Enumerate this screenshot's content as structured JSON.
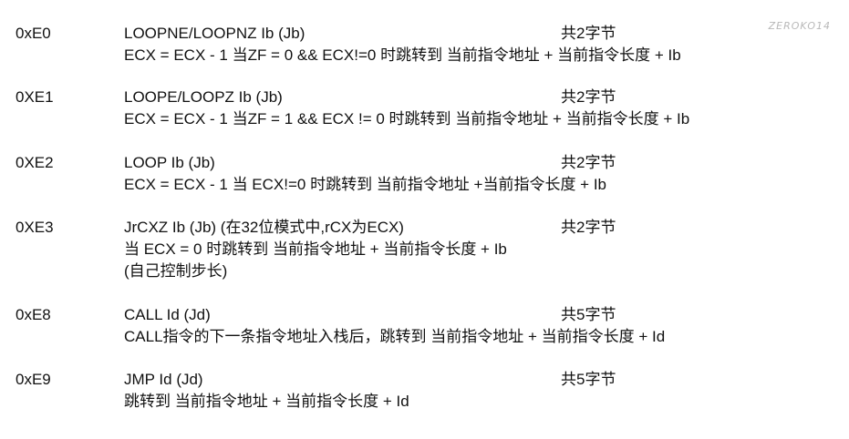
{
  "watermark": "ZEROKO14",
  "entries": [
    {
      "opcode": "0xE0",
      "mnemonic": "LOOPNE/LOOPNZ Ib (Jb)",
      "size": "共2字节",
      "lines": [
        "ECX = ECX - 1  当ZF = 0 && ECX!=0 时跳转到 当前指令地址 + 当前指令长度 + Ib"
      ]
    },
    {
      "opcode": "0XE1",
      "mnemonic": "LOOPE/LOOPZ Ib (Jb)",
      "size": "共2字节",
      "lines": [
        "ECX = ECX - 1  当ZF = 1 && ECX != 0 时跳转到 当前指令地址 + 当前指令长度 + Ib"
      ]
    },
    {
      "opcode": "0XE2",
      "mnemonic": "LOOP Ib (Jb)",
      "size": "共2字节",
      "lines": [
        "ECX = ECX - 1  当  ECX!=0 时跳转到 当前指令地址 +当前指令长度 + Ib"
      ]
    },
    {
      "opcode": "0XE3",
      "mnemonic": "JrCXZ Ib (Jb) (在32位模式中,rCX为ECX)",
      "size": "共2字节",
      "lines": [
        "当  ECX = 0 时跳转到 当前指令地址 + 当前指令长度 + Ib",
        "(自己控制步长)"
      ]
    },
    {
      "opcode": "0xE8",
      "mnemonic": "CALL Id (Jd)",
      "size": "共5字节",
      "lines": [
        "CALL指令的下一条指令地址入栈后，跳转到 当前指令地址 + 当前指令长度 + Id"
      ]
    },
    {
      "opcode": "0xE9",
      "mnemonic": "JMP Id (Jd)",
      "size": "共5字节",
      "lines": [
        "跳转到 当前指令地址 + 当前指令长度 + Id"
      ]
    }
  ]
}
